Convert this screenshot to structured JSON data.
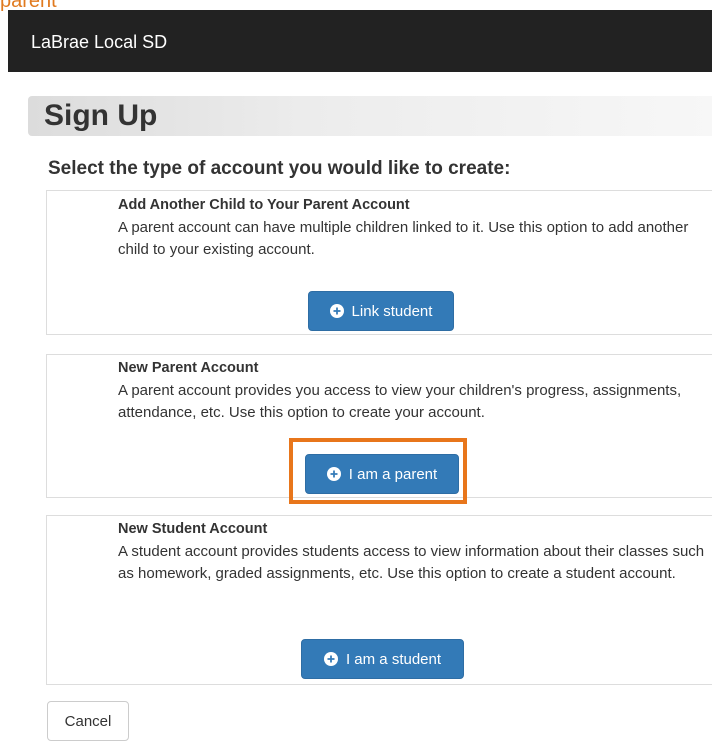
{
  "caption": "parent",
  "navbar": {
    "brand": "LaBrae Local SD"
  },
  "header": {
    "title": "Sign Up"
  },
  "prompt": "Select the type of account you would like to create:",
  "options": [
    {
      "title": "Add Another Child to Your Parent Account",
      "description": "A parent account can have multiple children linked to it. Use this option to add another child to your existing account.",
      "button_label": "Link student",
      "button_icon": "plus-circle-icon"
    },
    {
      "title": "New Parent Account",
      "description": "A parent account provides you access to view your children's progress, assignments, attendance, etc. Use this option to create your account.",
      "button_label": "I am a parent",
      "button_icon": "plus-circle-icon"
    },
    {
      "title": "New Student Account",
      "description": "A student account provides students access to view information about their classes such as homework, graded assignments, etc. Use this option to create a student account.",
      "button_label": "I am a student",
      "button_icon": "plus-circle-icon"
    }
  ],
  "cancel_label": "Cancel",
  "colors": {
    "navbar": "#222222",
    "primary": "#337ab7",
    "highlight": "#e8761b"
  }
}
